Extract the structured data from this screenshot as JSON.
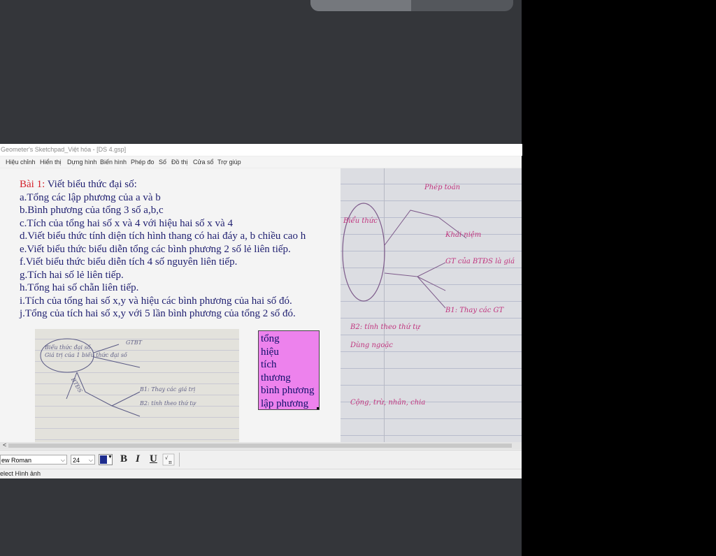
{
  "window": {
    "title": "Geometer's Sketchpad_Việt hóa - [DS 4.gsp]"
  },
  "menu": [
    "Hiệu chỉnh",
    "Hiển thị",
    "Dựng hình",
    "Biến hình",
    "Phép đo",
    "Số",
    "Đồ thị",
    "Cửa sổ",
    "Trợ giúp"
  ],
  "content": {
    "heading_prefix": "Bài 1:",
    "heading_text": " Viết biểu thức đại số:",
    "items": [
      "a.Tổng các lập phương của a và b",
      "b.Bình phương của tổng 3 số a,b,c",
      "c.Tích của tổng hai số x và 4 với hiệu hai số x và 4",
      "d.Viết biểu thức tính diện tích hình thang có hai đáy a, b chiều cao h",
      "e.Viết biểu thức biểu diễn tổng các bình phương 2 số lẻ liên tiếp.",
      "f.Viết biểu thức biểu diễn tích 4 số nguyên liên tiếp.",
      "g.Tích hai số lẻ liên tiếp.",
      "h.Tổng hai số chẵn liên tiếp.",
      "i.Tích của tổng hai số x,y và hiệu các bình phương của hai số đó.",
      "j.Tổng của tích hai số x,y với 5 lần bình phương của tổng 2 số đó."
    ],
    "keywords": [
      "tổng",
      "hiệu",
      "tích",
      "thương",
      "bình phương",
      "lập phương"
    ]
  },
  "notes_small": [
    "Biểu thức đại số",
    "Giá trị của 1 biểu thức đại số",
    "B1: Thay các giá trị",
    "B2: tính theo thứ tự",
    "GTBT",
    "BTĐS"
  ],
  "notes_large": [
    "Phép toán",
    "Biểu thức",
    "Khái niệm",
    "GT của BTĐS là giá",
    "B1: Thay các GT",
    "B2: tính theo thứ tự",
    "Dùng ngoặc",
    "Cộng, trừ, nhân, chia"
  ],
  "format_bar": {
    "font": "ew Roman",
    "size": "24",
    "color": "#1f2d8e",
    "bold": "B",
    "italic": "I",
    "underline": "U"
  },
  "status": "elect Hình ảnh"
}
